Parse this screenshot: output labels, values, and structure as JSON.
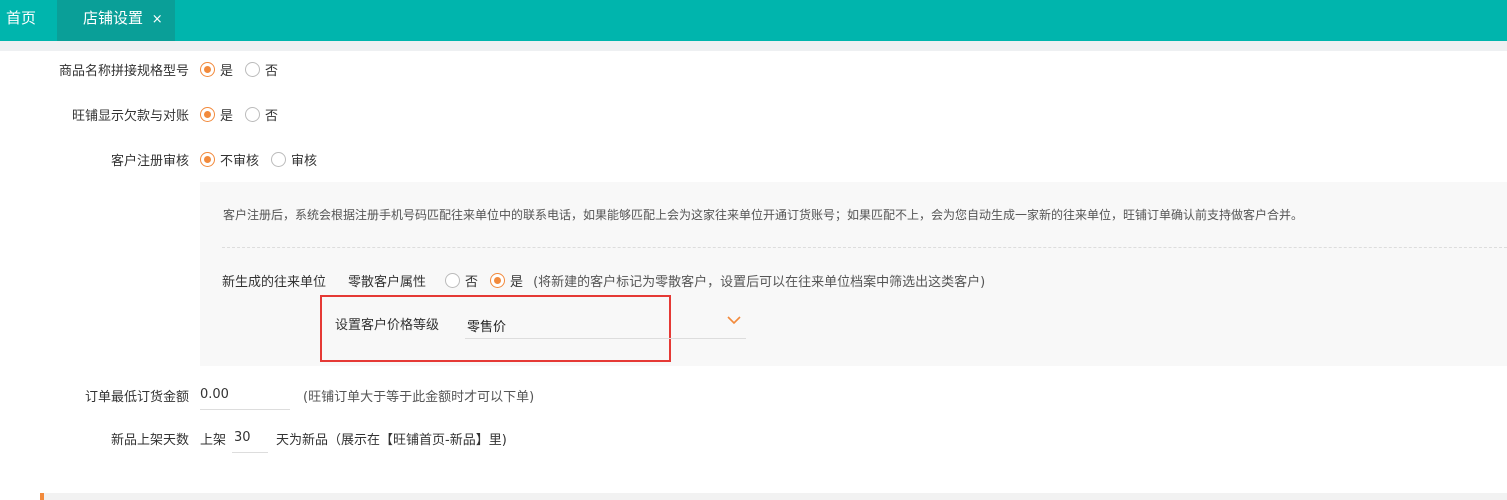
{
  "tabs": {
    "home": "首页",
    "active": "店铺设置",
    "close": "×"
  },
  "settings": {
    "spec_join": {
      "label": "商品名称拼接规格型号",
      "opt_yes": "是",
      "opt_no": "否",
      "selected": "yes"
    },
    "show_debt": {
      "label": "旺铺显示欠款与对账",
      "opt_yes": "是",
      "opt_no": "否",
      "selected": "yes"
    },
    "register_review": {
      "label": "客户注册审核",
      "opt_a": "不审核",
      "opt_b": "审核",
      "selected": "a"
    },
    "panel": {
      "description": "客户注册后，系统会根据注册手机号码匹配往来单位中的联系电话，如果能够匹配上会为这家往来单位开通订货账号；如果匹配不上，会为您自动生成一家新的往来单位，旺铺订单确认前支持做客户合并。",
      "new_unit_label": "新生成的往来单位",
      "retail_attr_label": "零散客户属性",
      "opt_no": "否",
      "opt_yes": "是",
      "selected": "yes",
      "retail_note": "(将新建的客户标记为零散客户，设置后可以在往来单位档案中筛选出这类客户)",
      "price_level_label": "设置客户价格等级",
      "price_level_value": "零售价"
    },
    "min_order": {
      "label": "订单最低订货金额",
      "value": "0.00",
      "note": "(旺铺订单大于等于此金额时才可以下单)"
    },
    "new_days": {
      "label": "新品上架天数",
      "prefix": "上架",
      "value": "30",
      "suffix": "天为新品（展示在【旺铺首页-新品】里)"
    }
  },
  "colors": {
    "header": "#00b5ad",
    "accent": "#f28a3c",
    "highlight_box": "#e53935"
  },
  "icons": {
    "dropdown": "chevron-down-icon"
  }
}
